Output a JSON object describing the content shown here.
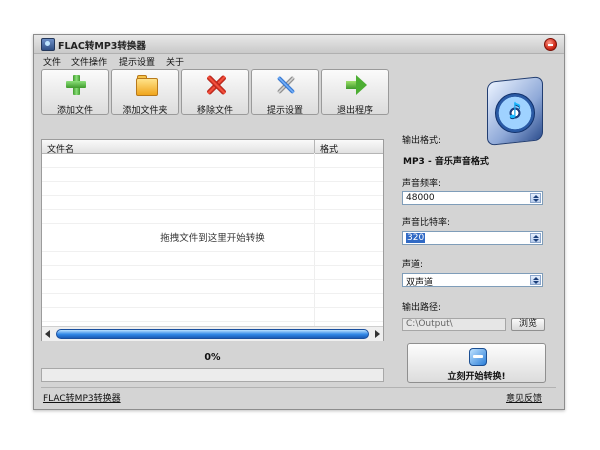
{
  "window": {
    "title": "FLAC转MP3转换器"
  },
  "menu": [
    "文件",
    "文件操作",
    "提示设置",
    "关于"
  ],
  "toolbar": {
    "add_file": "添加文件",
    "add_folder": "添加文件夹",
    "remove_file": "移除文件",
    "settings": "提示设置",
    "exit": "退出程序"
  },
  "file_list": {
    "col_name": "文件名",
    "col_format": "格式",
    "drop_hint": "拖拽文件到这里开始转换"
  },
  "progress": {
    "percent_text": "0%",
    "value": 0
  },
  "output": {
    "format_label": "输出格式:",
    "format_value": "MP3 - 音乐声音格式",
    "frequency_label": "声音频率:",
    "frequency_value": "48000",
    "bitrate_label": "声音比特率:",
    "bitrate_value": "320",
    "channel_label": "声道:",
    "channel_value": "双声道",
    "path_label": "输出路径:",
    "path_value": "C:\\Output\\",
    "browse": "浏览"
  },
  "start_button": "立刻开始转换!",
  "footer": {
    "left_link": "FLAC转MP3转换器",
    "right_link": "意见反馈"
  }
}
